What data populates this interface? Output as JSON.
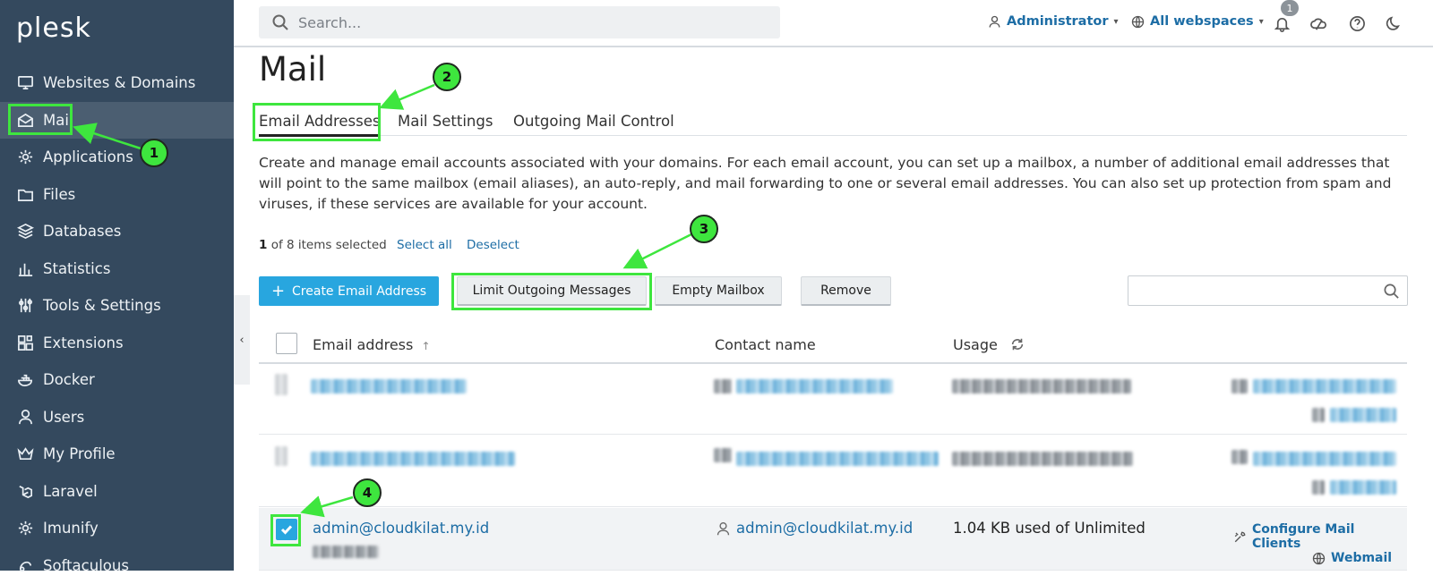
{
  "logo": {
    "text": "plesk"
  },
  "sidebar": {
    "items": [
      {
        "label": "Websites & Domains",
        "icon": "monitor-icon"
      },
      {
        "label": "Mail",
        "icon": "mail-icon",
        "active": true
      },
      {
        "label": "Applications",
        "icon": "gear-icon"
      },
      {
        "label": "Files",
        "icon": "folder-icon"
      },
      {
        "label": "Databases",
        "icon": "layers-icon"
      },
      {
        "label": "Statistics",
        "icon": "bar-chart-icon"
      },
      {
        "label": "Tools & Settings",
        "icon": "sliders-icon"
      },
      {
        "label": "Extensions",
        "icon": "extensions-icon"
      },
      {
        "label": "Docker",
        "icon": "docker-icon"
      },
      {
        "label": "Users",
        "icon": "user-icon"
      },
      {
        "label": "My Profile",
        "icon": "crown-icon"
      },
      {
        "label": "Laravel",
        "icon": "laravel-icon"
      },
      {
        "label": "Imunify",
        "icon": "shield-gear-icon"
      },
      {
        "label": "Softaculous",
        "icon": "softaculous-icon"
      }
    ],
    "collapse_glyph": "‹"
  },
  "topbar": {
    "search_placeholder": "Search...",
    "user_label": "Administrator",
    "webspaces_label": "All webspaces",
    "notification_count": "1"
  },
  "page": {
    "title": "Mail",
    "tabs": [
      "Email Addresses",
      "Mail Settings",
      "Outgoing Mail Control"
    ],
    "description": "Create and manage email accounts associated with your domains. For each email account, you can set up a mailbox, a number of additional email addresses that will point to the same mailbox (email aliases), an auto-reply, and mail forwarding to one or several email addresses. You can also set up protection from spam and viruses, if these services are available for your account.",
    "selection": {
      "count": "1",
      "suffix": "of 8 items selected",
      "select_all": "Select all",
      "deselect": "Deselect"
    }
  },
  "toolbar": {
    "create_label": "Create Email Address",
    "create_plus": "+",
    "limit_label": "Limit Outgoing Messages",
    "empty_label": "Empty Mailbox",
    "remove_label": "Remove"
  },
  "table": {
    "columns": {
      "email": "Email address",
      "sort_arrow": "↑",
      "contact": "Contact name",
      "usage": "Usage"
    },
    "selected_row": {
      "email": "admin@cloudkilat.my.id",
      "contact": "admin@cloudkilat.my.id",
      "usage": "1.04 KB used of Unlimited",
      "configure_label": "Configure Mail Clients",
      "webmail_label": "Webmail"
    }
  },
  "callouts": [
    "1",
    "2",
    "3",
    "4"
  ],
  "colors": {
    "sidebar_bg": "#34495e",
    "accent": "#28a6df",
    "link": "#1d6da5",
    "annotation": "#3ee63e"
  }
}
